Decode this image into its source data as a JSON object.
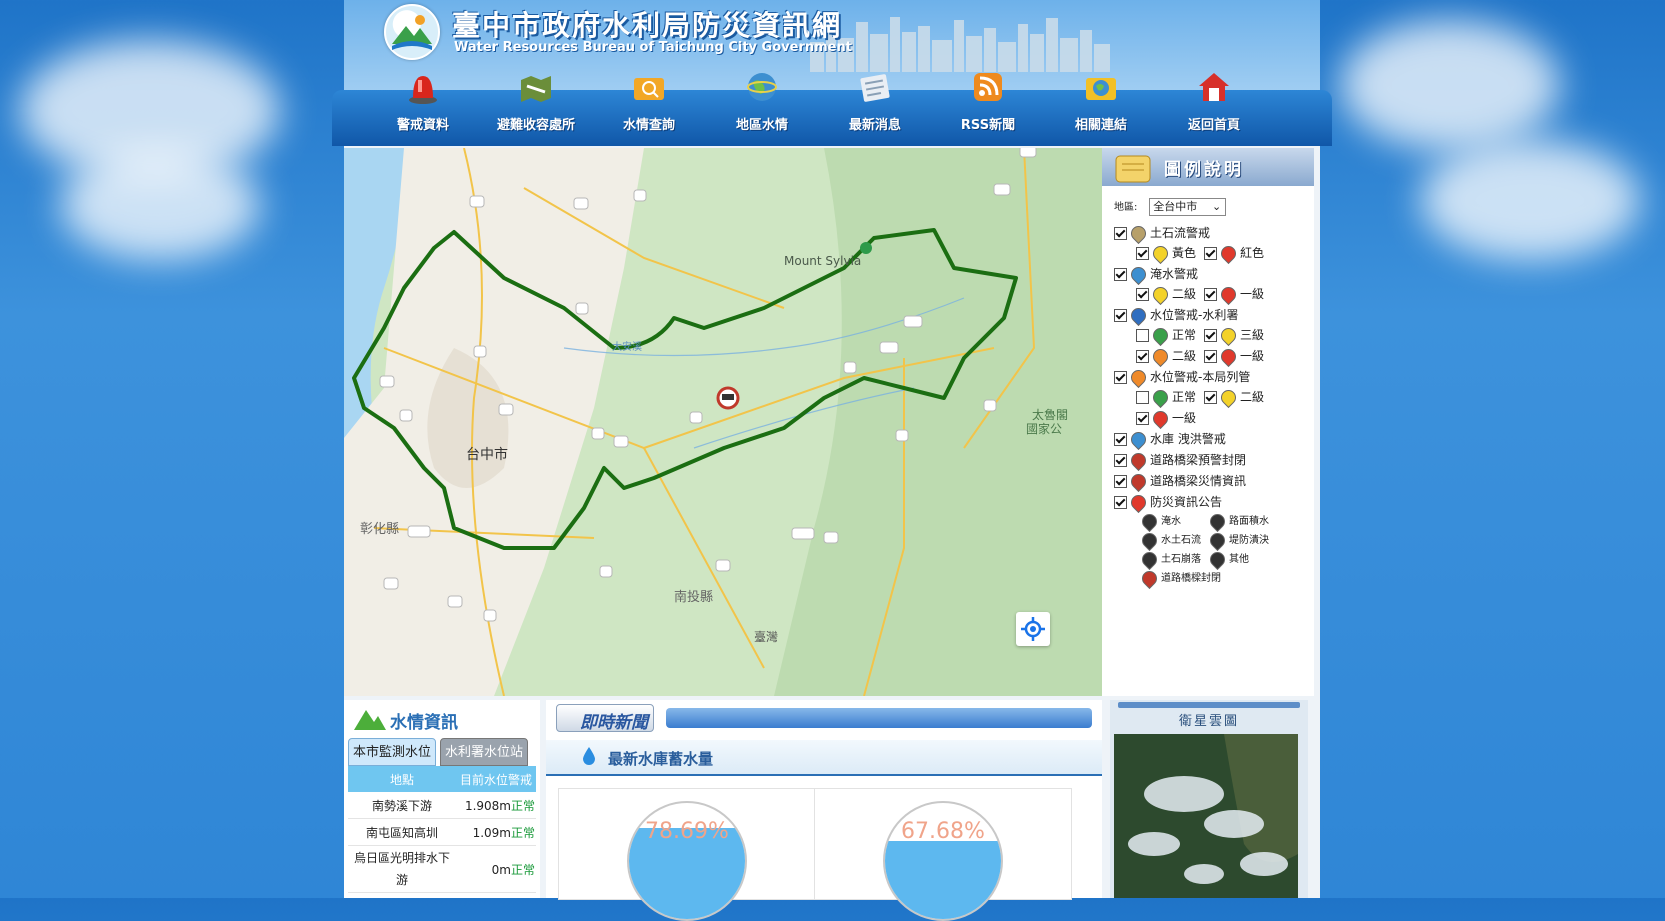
{
  "header": {
    "title": "臺中市政府水利局防災資訊網",
    "subtitle": "Water Resources Bureau of Taichung City Government"
  },
  "nav": [
    {
      "label": "警戒資料",
      "icon": "alarm-light-icon"
    },
    {
      "label": "避難收容處所",
      "icon": "shelter-map-icon"
    },
    {
      "label": "水情查詢",
      "icon": "folder-search-icon"
    },
    {
      "label": "地區水情",
      "icon": "globe-icon"
    },
    {
      "label": "最新消息",
      "icon": "newspaper-icon"
    },
    {
      "label": "RSS新聞",
      "icon": "rss-icon"
    },
    {
      "label": "相關連結",
      "icon": "link-globe-icon"
    },
    {
      "label": "返回首頁",
      "icon": "home-icon"
    }
  ],
  "map": {
    "labels": {
      "mount": "Mount Sylvia",
      "city": "台中市",
      "county1": "彰化縣",
      "county2": "南投縣",
      "taiwan": "臺灣",
      "park1": "太魯閣",
      "park2": "國家公",
      "river": "大安溪"
    },
    "road_shields": [
      "7甲",
      "7甲",
      "3",
      "72",
      "61",
      "3",
      "4",
      "61",
      "3",
      "74",
      "74甲",
      "76",
      "76",
      "3",
      "7甲",
      "7甲",
      "8",
      "8",
      "8",
      "8",
      "21",
      "14甲",
      "14",
      "14",
      "6",
      "8"
    ]
  },
  "legend": {
    "title": "圖例說明",
    "area_label": "地區:",
    "area_value": "全台中市",
    "items": [
      {
        "label": "土石流警戒",
        "checked": true
      },
      {
        "label": "黃色",
        "checked": true
      },
      {
        "label": "紅色",
        "checked": true
      },
      {
        "label": "淹水警戒",
        "checked": true
      },
      {
        "label": "二級",
        "checked": true
      },
      {
        "label": "一級",
        "checked": true
      },
      {
        "label": "水位警戒-水利署",
        "checked": true
      },
      {
        "label": "正常",
        "checked": false
      },
      {
        "label": "三級",
        "checked": true
      },
      {
        "label": "二級",
        "checked": true
      },
      {
        "label": "一級",
        "checked": true
      },
      {
        "label": "水位警戒-本局列管",
        "checked": true
      },
      {
        "label": "正常",
        "checked": false
      },
      {
        "label": "二級",
        "checked": true
      },
      {
        "label": "一級",
        "checked": true
      },
      {
        "label": "水庫 洩洪警戒",
        "checked": true
      },
      {
        "label": "道路橋梁預警封閉",
        "checked": true
      },
      {
        "label": "道路橋梁災情資訊",
        "checked": true
      },
      {
        "label": "防災資訊公告",
        "checked": true
      }
    ],
    "announce": [
      "淹水",
      "路面積水",
      "水土石流",
      "堤防潰決",
      "土石崩落",
      "其他",
      "道路橋樑封閉"
    ]
  },
  "water_info": {
    "title": "水情資訊",
    "tabs": [
      "本市監測水位",
      "水利署水位站"
    ],
    "columns": [
      "地點",
      "目前水位警戒"
    ],
    "rows": [
      {
        "place": "南勢溪下游",
        "level": "1.908m",
        "status": "正常"
      },
      {
        "place": "南屯區知高圳",
        "level": "1.09m",
        "status": "正常"
      },
      {
        "place": "烏日區光明排水下游",
        "level": "0m",
        "status": "正常"
      }
    ]
  },
  "news": {
    "title": "即時新聞",
    "reservoir_title": "最新水庫蓄水量",
    "gauges": [
      {
        "percent_text": "78.69%",
        "fraction": 0.7869
      },
      {
        "percent_text": "67.68%",
        "fraction": 0.6768
      }
    ]
  },
  "satellite": {
    "title": "衛星雲圖"
  },
  "colors": {
    "boundary": "#1b6e12",
    "nav_dark": "#1057a8",
    "ok_status": "#1a9a3a",
    "gauge_water": "#5db8ef"
  }
}
